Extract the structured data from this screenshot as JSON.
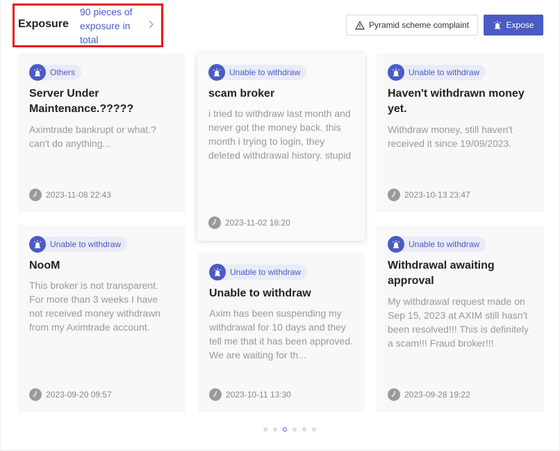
{
  "header": {
    "title": "Exposure",
    "count_text": "90 pieces of exposure in total",
    "complaint_button": "Pyramid scheme complaint",
    "expose_button": "Expose"
  },
  "cards": [
    {
      "tag": "Others",
      "title": "Server Under Maintenance.?????",
      "body": "Aximtrade bankrupt or what.? can't do anything...",
      "time": "2023-11-08 22:43"
    },
    {
      "tag": "Unable to withdraw",
      "title": "scam broker",
      "body": "i tried to withdraw last month and never got the money back. this month i trying to login, they deleted withdrawal history. stupid broker",
      "time": "2023-11-02 18:20"
    },
    {
      "tag": "Unable to withdraw",
      "title": "Haven't withdrawn money yet.",
      "body": "Withdraw money, still haven't received it since 19/09/2023.",
      "time": "2023-10-13 23:47"
    },
    {
      "tag": "Unable to withdraw",
      "title": "NooM",
      "body": "This broker is not transparent. For more than 3 weeks I have not received money withdrawn from my Aximtrade account.",
      "time": "2023-09-20 09:57"
    },
    {
      "tag": "Unable to withdraw",
      "title": "Unable to withdraw",
      "body": "Axim has been suspending my withdrawal for 10 days and they tell me that it has been approved. We are waiting for th...",
      "time": "2023-10-11 13:30"
    },
    {
      "tag": "Unable to withdraw",
      "title": "Withdrawal awaiting approval",
      "body": "My withdrawal request made on Sep 15, 2023 at AXIM still hasn't been resolved!!! This is definitely a scam!!! Fraud broker!!!",
      "time": "2023-09-28 19:22"
    }
  ],
  "pagination": {
    "count": 6,
    "active_index": 2
  },
  "colors": {
    "accent": "#4a5bc4",
    "highlight_border": "#e8141b"
  },
  "icons": {
    "tag": "tag-badge-icon",
    "time": "clock-icon",
    "warning": "warning-icon",
    "more": "chevron-right-icon"
  }
}
